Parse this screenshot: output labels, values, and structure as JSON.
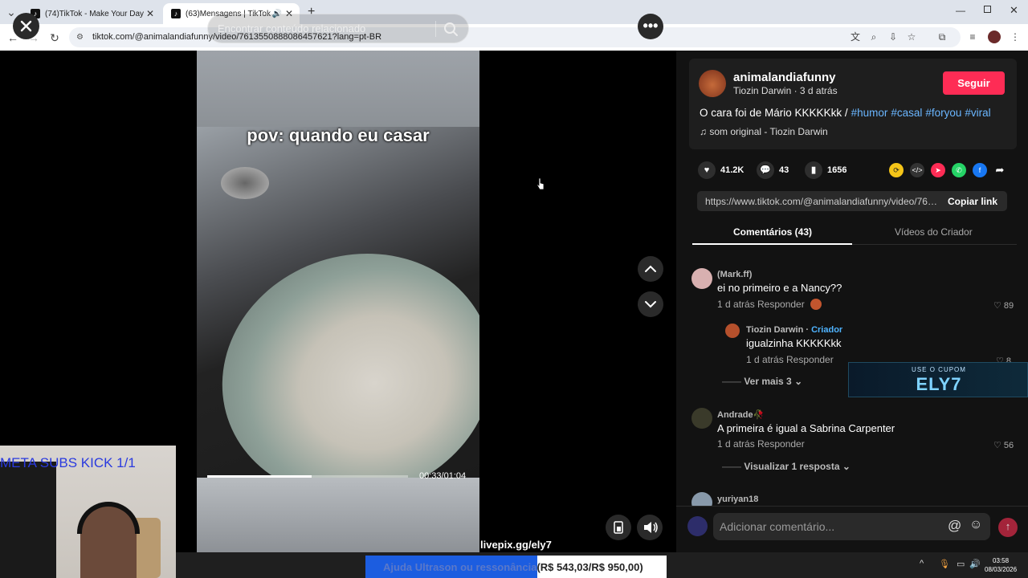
{
  "browser": {
    "tabs": [
      {
        "title": "(74)TikTok - Make Your Day"
      },
      {
        "title": "(63)Mensagens | TikTok"
      }
    ],
    "new_tab": "+",
    "url": "tiktok.com/@animalandiafunny/video/7613550888086457621?lang=pt-BR"
  },
  "player": {
    "search_placeholder": "Encontrar conteúdo relacionado",
    "caption": "pov: quando eu casar",
    "time": "00:33/01:04",
    "progress": 0.52
  },
  "overlay": {
    "meta_subs": "META SUBS KICK 1/1",
    "livepix": "livepix.gg/ely7",
    "goal_label": "Ajuda Ultrason ou ressonância",
    "goal_amount": "(R$ 543,03/R$ 950,00)",
    "goal_progress": 0.57,
    "coupon_top": "USE O CUPOM",
    "coupon_code": "ELY7"
  },
  "post": {
    "username": "animalandiafunny",
    "subline": "Tiozin Darwin · 3 d atrás",
    "follow_label": "Seguir",
    "description": "O cara foi de Mário KKKKKkk /",
    "hashtags": [
      "#humor",
      "#casal",
      "#foryou",
      "#viral"
    ],
    "music": "♫  som original - Tiozin Darwin",
    "likes": "41.2K",
    "comments": "43",
    "saves": "1656",
    "link": "https://www.tiktok.com/@animalandiafunny/video/761...",
    "copy_label": "Copiar link"
  },
  "tabs": {
    "comments": "Comentários (43)",
    "creator_videos": "Vídeos do Criador"
  },
  "comments": [
    {
      "name": "(Mark.ff)",
      "text": "ei no primeiro e a Nancy??",
      "meta": "1 d atrás",
      "reply": "Responder",
      "likes": "89"
    },
    {
      "name": "Tiozin Darwin · ",
      "badge": "Criador",
      "text": "igualzinha KKKKKkk",
      "meta": "1 d atrás",
      "reply": "Responder",
      "likes": "8"
    },
    {
      "name": "Andrade🥀",
      "text": "A primeira é igual a Sabrina Carpenter",
      "meta": "1 d atrás",
      "reply": "Responder",
      "likes": "56"
    },
    {
      "name": "yuriyan18"
    }
  ],
  "see_more": "Ver mais 3",
  "view_reply": "Visualizar 1 resposta",
  "comment_placeholder": "Adicionar comentário...",
  "clock": {
    "time": "03:58",
    "date": "08/03/2026"
  }
}
